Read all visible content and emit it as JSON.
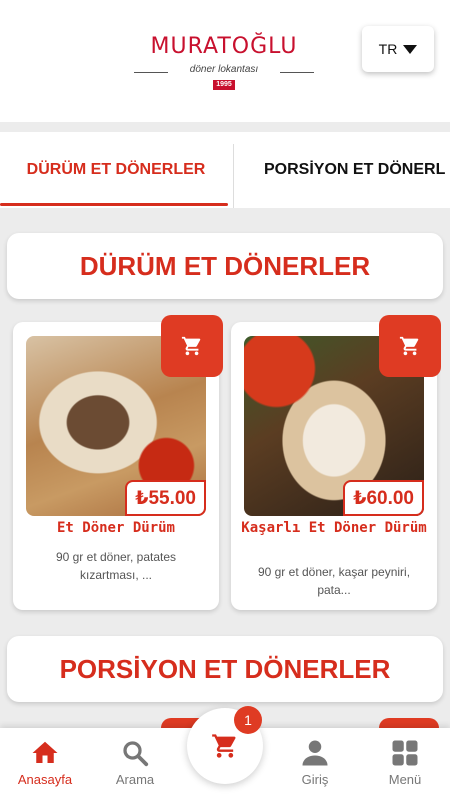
{
  "brand": {
    "name": "MURATOĞLU",
    "subtitle": "döner lokantası",
    "year": "1995"
  },
  "language": {
    "selected": "TR"
  },
  "tabs": [
    {
      "label": "DÜRÜM ET DÖNERLER",
      "active": true
    },
    {
      "label": "PORSİYON ET DÖNERL",
      "active": false
    }
  ],
  "sections": [
    {
      "title": "DÜRÜM ET DÖNERLER",
      "products": [
        {
          "name": "Et Döner Dürüm",
          "price": "₺55.00",
          "description": "90 gr et döner, patates kızartması, ..."
        },
        {
          "name": "Kaşarlı Et Döner Dürüm",
          "price": "₺60.00",
          "description": "90 gr et döner, kaşar peyniri, pata..."
        }
      ]
    },
    {
      "title": "PORSİYON ET DÖNERLER"
    }
  ],
  "bottom_nav": {
    "home": "Anasayfa",
    "search": "Arama",
    "cart_count": "1",
    "login": "Giriş",
    "menu": "Menü"
  },
  "colors": {
    "accent": "#d62d1d",
    "cart_button": "#df3b23",
    "background": "#ececec"
  }
}
